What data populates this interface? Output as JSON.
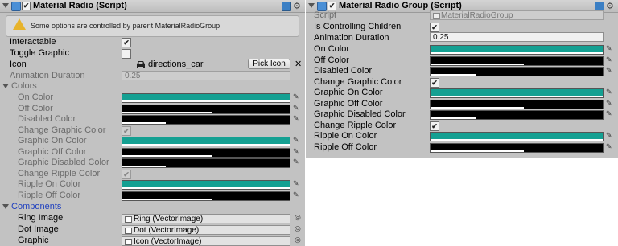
{
  "left": {
    "header": {
      "title": "Material Radio (Script)",
      "enabled_mark": "✔",
      "gear": "⚙"
    },
    "warning": "Some options are controlled by parent MaterialRadioGroup",
    "interactable_label": "Interactable",
    "toggle_graphic_label": "Toggle Graphic",
    "icon_label": "Icon",
    "icon_value": "directions_car",
    "pick_icon": "Pick Icon",
    "close": "✕",
    "anim_label": "Animation Duration",
    "anim_value": "0.25",
    "colors_section": "Colors",
    "color_rows": [
      {
        "label": "On Color",
        "color": "#14a092",
        "alpha": 1.0
      },
      {
        "label": "Off Color",
        "color": "#000000",
        "alpha": 0.54
      },
      {
        "label": "Disabled Color",
        "color": "#000000",
        "alpha": 0.26
      }
    ],
    "change_graphic_label": "Change Graphic Color",
    "graphic_rows": [
      {
        "label": "Graphic On Color",
        "color": "#14a092",
        "alpha": 1.0
      },
      {
        "label": "Graphic Off Color",
        "color": "#000000",
        "alpha": 0.54
      },
      {
        "label": "Graphic Disabled Color",
        "color": "#000000",
        "alpha": 0.26
      }
    ],
    "change_ripple_label": "Change Ripple Color",
    "ripple_rows": [
      {
        "label": "Ripple On Color",
        "color": "#14a092",
        "alpha": 1.0
      },
      {
        "label": "Ripple Off Color",
        "color": "#000000",
        "alpha": 0.54
      }
    ],
    "components_section": "Components",
    "components": [
      {
        "label": "Ring Image",
        "value": "Ring (VectorImage)"
      },
      {
        "label": "Dot Image",
        "value": "Dot (VectorImage)"
      },
      {
        "label": "Graphic",
        "value": "Icon (VectorImage)"
      }
    ],
    "checks": {
      "interactable": "✔",
      "toggle_graphic": "",
      "change_graphic": "✔",
      "change_ripple": "✔"
    },
    "picker_glyph": "✎",
    "object_circle": "◎"
  },
  "right": {
    "header": {
      "title": "Material Radio Group (Script)",
      "enabled_mark": "✔",
      "gear": "⚙"
    },
    "script_label": "Script",
    "script_value": "MaterialRadioGroup",
    "controlling_label": "Is Controlling Children",
    "anim_label": "Animation Duration",
    "anim_value": "0.25",
    "color_rows": [
      {
        "label": "On Color",
        "color": "#14a092",
        "alpha": 1.0
      },
      {
        "label": "Off Color",
        "color": "#000000",
        "alpha": 0.54
      },
      {
        "label": "Disabled Color",
        "color": "#000000",
        "alpha": 0.26
      }
    ],
    "change_graphic_label": "Change Graphic Color",
    "graphic_rows": [
      {
        "label": "Graphic On Color",
        "color": "#14a092",
        "alpha": 1.0
      },
      {
        "label": "Graphic Off Color",
        "color": "#000000",
        "alpha": 0.54
      },
      {
        "label": "Graphic Disabled Color",
        "color": "#000000",
        "alpha": 0.26
      }
    ],
    "change_ripple_label": "Change Ripple Color",
    "ripple_rows": [
      {
        "label": "Ripple On Color",
        "color": "#14a092",
        "alpha": 1.0
      },
      {
        "label": "Ripple Off Color",
        "color": "#000000",
        "alpha": 0.54
      }
    ],
    "checks": {
      "controlling": "✔",
      "change_graphic": "✔",
      "change_ripple": "✔"
    }
  }
}
